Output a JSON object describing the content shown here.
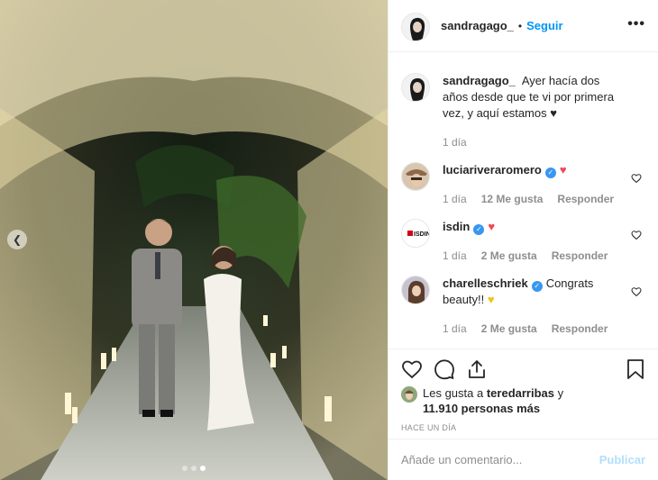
{
  "post": {
    "username": "sandragago_",
    "separator": "•",
    "follow_label": "Seguir",
    "more_icon": "more-options-icon"
  },
  "caption": {
    "username": "sandragago_",
    "text": "Ayer hacía dos años desde que te vi por primera vez, y aquí estamos ♥",
    "time": "1 día"
  },
  "comments": [
    {
      "username": "luciariveraromero",
      "text": "",
      "emoji": "♥",
      "emoji_kind": "red",
      "time": "1 día",
      "likes": "12 Me gusta",
      "reply": "Responder"
    },
    {
      "username": "isdin",
      "text": "",
      "emoji": "♥",
      "emoji_kind": "red",
      "time": "1 día",
      "likes": "2 Me gusta",
      "reply": "Responder"
    },
    {
      "username": "charelleschriek",
      "text": "Congrats beauty!!",
      "emoji": "♥",
      "emoji_kind": "yellow",
      "time": "1 día",
      "likes": "2 Me gusta",
      "reply": "Responder"
    }
  ],
  "likes": {
    "prefix": "Les gusta a",
    "user": "teredarribas",
    "conj": "y",
    "count": "11.910 personas más"
  },
  "timestamp": "HACE UN DÍA",
  "add_comment": {
    "placeholder": "Añade un comentario...",
    "publish_label": "Publicar"
  },
  "carousel": {
    "total": 3,
    "active": 3
  },
  "colors": {
    "link_blue": "#0095f6",
    "publish_disabled": "#b2dffc",
    "heart_red": "#ed4956",
    "verified_blue": "#3897f0",
    "muted_gray": "#8e8e8e"
  }
}
